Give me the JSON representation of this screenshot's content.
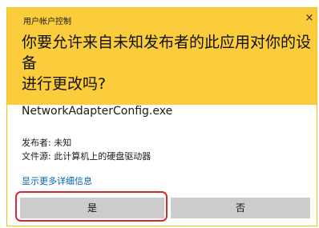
{
  "window": {
    "title": "用户帐户控制",
    "close_glyph": "×"
  },
  "prompt": {
    "question": "你要允许来自未知发布者的此应用对你的设备\n进行更改吗?",
    "app_name": "NetworkAdapterConfig.exe",
    "publisher_line": "发布者: 未知",
    "origin_line": "文件源: 此计算机上的硬盘驱动器",
    "details_link": "显示更多详细信息"
  },
  "buttons": {
    "yes_label": "是",
    "no_label": "否"
  },
  "colors": {
    "header_bg": "#fbcc3c",
    "button_bg": "#cccccc",
    "link": "#0063b1",
    "highlight": "#d8282f"
  }
}
